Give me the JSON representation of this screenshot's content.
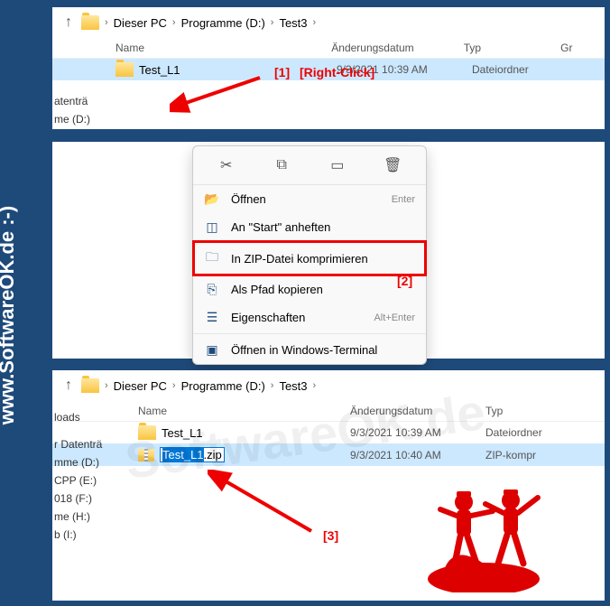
{
  "sidebar": {
    "text": "www.SoftwareOK.de :-)"
  },
  "watermark": "SoftwareOK.de",
  "breadcrumbs": {
    "items": [
      "Dieser PC",
      "Programme (D:)",
      "Test3"
    ]
  },
  "columns": {
    "name": "Name",
    "date": "Änderungsdatum",
    "type": "Typ",
    "size": "Gr"
  },
  "panel1": {
    "file": {
      "name": "Test_L1",
      "date": "9/3/2021 10:39 AM",
      "type": "Dateiordner"
    }
  },
  "tree1": {
    "items": [
      "atenträ",
      "me (D:)"
    ]
  },
  "tree3": {
    "items": [
      "loads",
      "r Datenträ",
      "mme (D:)",
      "CPP (E:)",
      "018 (F:)",
      "me (H:)",
      "b (I:)"
    ]
  },
  "context_menu": {
    "open": "Öffnen",
    "open_shortcut": "Enter",
    "pin": "An \"Start\" anheften",
    "zip": "In ZIP-Datei komprimieren",
    "copy_path": "Als Pfad kopieren",
    "properties": "Eigenschaften",
    "properties_shortcut": "Alt+Enter",
    "terminal": "Öffnen in Windows-Terminal"
  },
  "panel3": {
    "file1": {
      "name": "Test_L1",
      "date": "9/3/2021 10:39 AM",
      "type": "Dateiordner"
    },
    "file2": {
      "name_sel": "Test_L1",
      "name_ext": ".zip",
      "date": "9/3/2021 10:40 AM",
      "type": "ZIP-kompr"
    }
  },
  "annotations": {
    "a1": "[1]",
    "a1_text": "[Right-Click]",
    "a2": "[2]",
    "a3": "[3]"
  }
}
